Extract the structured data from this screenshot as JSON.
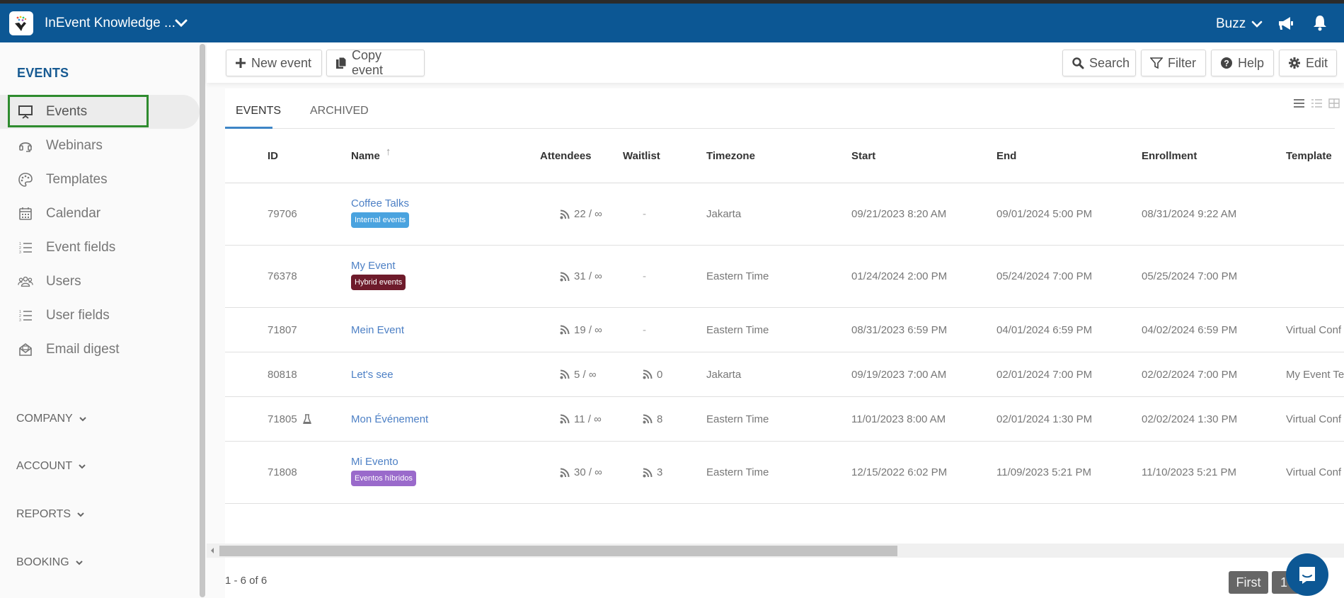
{
  "topbar": {
    "app_title": "InEvent Knowledge ...",
    "user_name": "Buzz"
  },
  "sidebar": {
    "section_title": "EVENTS",
    "items": [
      {
        "label": "Events",
        "icon": "presentation-board-icon",
        "active": true
      },
      {
        "label": "Webinars",
        "icon": "headset-icon",
        "active": false
      },
      {
        "label": "Templates",
        "icon": "palette-icon",
        "active": false
      },
      {
        "label": "Calendar",
        "icon": "calendar-icon",
        "active": false
      },
      {
        "label": "Event fields",
        "icon": "numbered-list-icon",
        "active": false
      },
      {
        "label": "Users",
        "icon": "users-icon",
        "active": false
      },
      {
        "label": "User fields",
        "icon": "numbered-list-icon",
        "active": false
      },
      {
        "label": "Email digest",
        "icon": "envelope-open-icon",
        "active": false
      }
    ],
    "groups": [
      {
        "label": "COMPANY"
      },
      {
        "label": "ACCOUNT"
      },
      {
        "label": "REPORTS"
      },
      {
        "label": "BOOKING"
      }
    ]
  },
  "toolbar": {
    "new_event": "New event",
    "copy_event": "Copy event",
    "search": "Search",
    "filter": "Filter",
    "help": "Help",
    "edit": "Edit"
  },
  "tabs": [
    {
      "label": "EVENTS",
      "active": true
    },
    {
      "label": "ARCHIVED",
      "active": false
    }
  ],
  "table": {
    "columns": {
      "id": "ID",
      "name": "Name",
      "attendees": "Attendees",
      "waitlist": "Waitlist",
      "timezone": "Timezone",
      "start": "Start",
      "end": "End",
      "enrollment": "Enrollment",
      "template": "Template"
    },
    "sort_indicator": "↑",
    "rows": [
      {
        "id": "79706",
        "name": "Coffee Talks",
        "badge": "Internal events",
        "badge_color": "#4aa3df",
        "attendees": "22 / ∞",
        "waitlist": "-",
        "waitlist_icon": false,
        "timezone": "Jakarta",
        "start": "09/21/2023 8:20 AM",
        "end": "09/01/2024 5:00 PM",
        "enrollment": "08/31/2024 9:22 AM",
        "template": "",
        "test_icon": false
      },
      {
        "id": "76378",
        "name": "My Event",
        "badge": "Hybrid events",
        "badge_color": "#6e1b2b",
        "attendees": "31 / ∞",
        "waitlist": "-",
        "waitlist_icon": false,
        "timezone": "Eastern Time",
        "start": "01/24/2024 2:00 PM",
        "end": "05/24/2024 7:00 PM",
        "enrollment": "05/25/2024 7:00 PM",
        "template": "",
        "test_icon": false
      },
      {
        "id": "71807",
        "name": "Mein Event",
        "badge": "",
        "badge_color": "",
        "attendees": "19 / ∞",
        "waitlist": "-",
        "waitlist_icon": false,
        "timezone": "Eastern Time",
        "start": "08/31/2023 6:59 PM",
        "end": "04/01/2024 6:59 PM",
        "enrollment": "04/02/2024 6:59 PM",
        "template": "Virtual Conf",
        "test_icon": false
      },
      {
        "id": "80818",
        "name": "Let's see",
        "badge": "",
        "badge_color": "",
        "attendees": "5 / ∞",
        "waitlist": "0",
        "waitlist_icon": true,
        "timezone": "Jakarta",
        "start": "09/19/2023 7:00 AM",
        "end": "02/01/2024 7:00 PM",
        "enrollment": "02/02/2024 7:00 PM",
        "template": "My Event Te",
        "test_icon": false
      },
      {
        "id": "71805",
        "name": "Mon Événement",
        "badge": "",
        "badge_color": "",
        "attendees": "11 / ∞",
        "waitlist": "8",
        "waitlist_icon": true,
        "timezone": "Eastern Time",
        "start": "11/01/2023 8:00 AM",
        "end": "02/01/2024 1:30 PM",
        "enrollment": "02/02/2024 1:30 PM",
        "template": "Virtual Conf",
        "test_icon": true
      },
      {
        "id": "71808",
        "name": "Mi Evento",
        "badge": "Eventos híbridos",
        "badge_color": "#9a6acb",
        "attendees": "30 / ∞",
        "waitlist": "3",
        "waitlist_icon": true,
        "timezone": "Eastern Time",
        "start": "12/15/2022 6:02 PM",
        "end": "11/09/2023 5:21 PM",
        "enrollment": "11/10/2023 5:21 PM",
        "template": "Virtual Conf",
        "test_icon": false
      }
    ]
  },
  "pagination": {
    "info": "1 - 6 of 6",
    "first": "First",
    "page": "1"
  }
}
